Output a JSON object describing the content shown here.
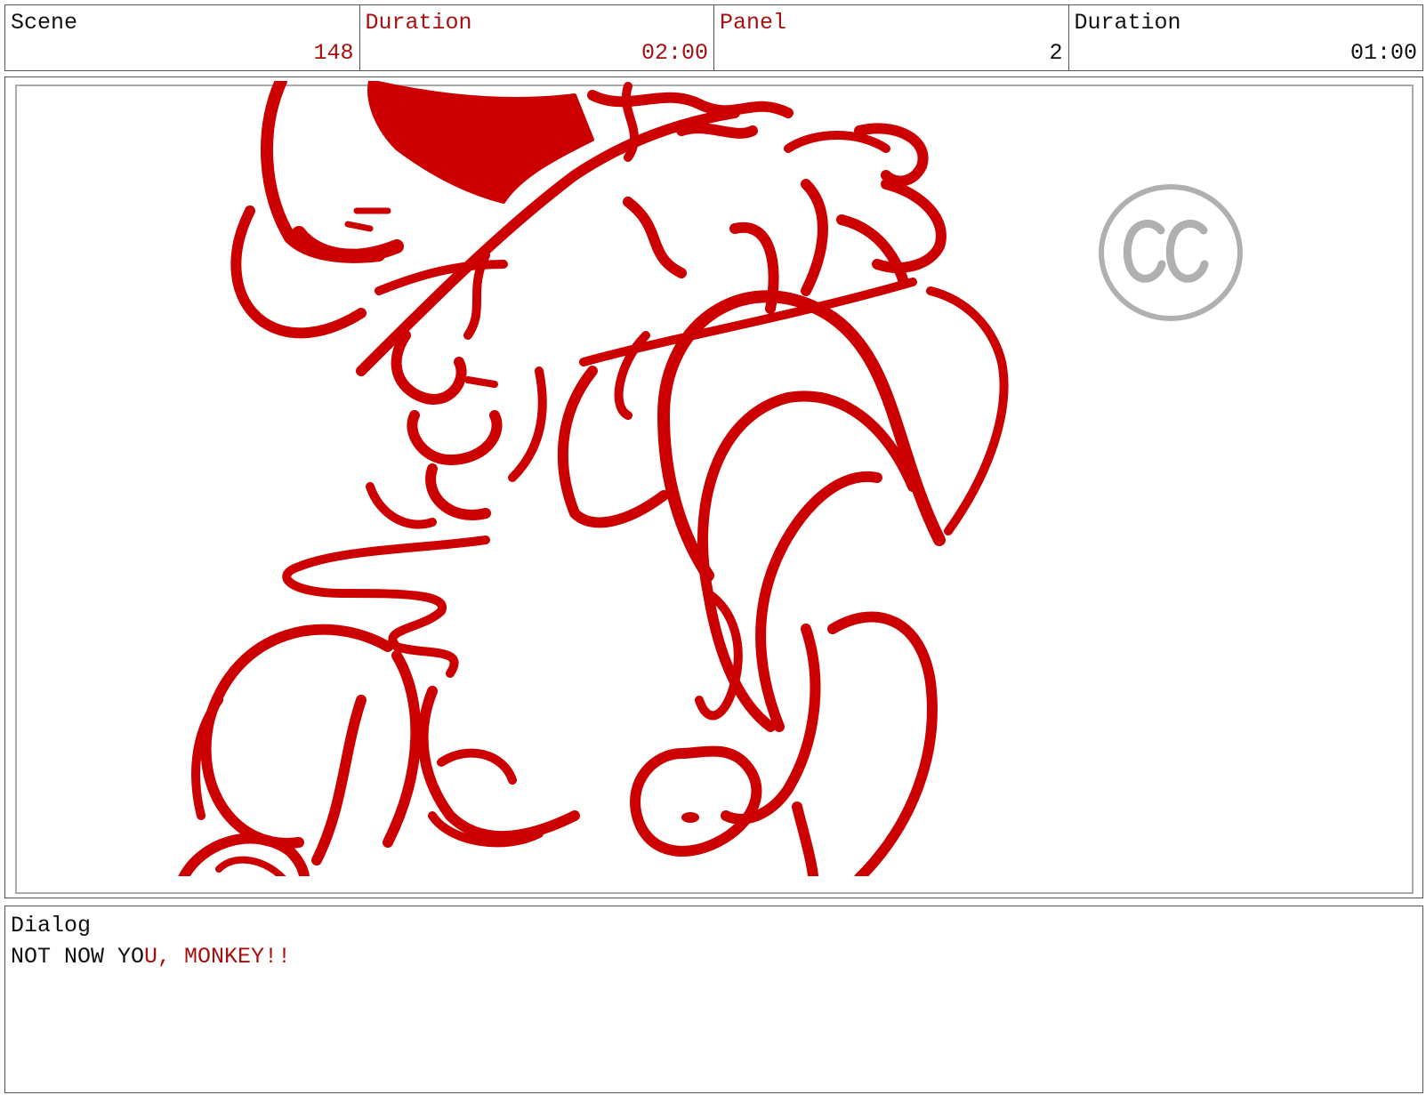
{
  "header": {
    "scene_label": "Scene",
    "scene_value": "148",
    "duration_label": "Duration",
    "duration_value": "02:00",
    "panel_label": "Panel",
    "panel_value": "2",
    "panel_duration_label": "Duration",
    "panel_duration_value": "01:00"
  },
  "panel": {
    "watermark_text": "CC",
    "sketch_color": "#cc0000",
    "watermark_color": "#b0b0b0"
  },
  "dialog": {
    "label": "Dialog",
    "line_part1": "NOT NOW YO",
    "line_part2": "U, MONKEY!!"
  }
}
